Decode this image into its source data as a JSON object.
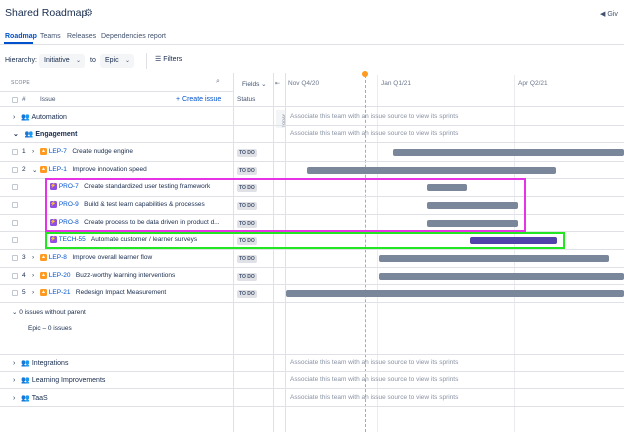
{
  "header": {
    "title": "Shared Roadmap",
    "gear_icon": "gear-icon",
    "give_label": "Giv"
  },
  "tabs": [
    {
      "label": "Roadmap",
      "active": true
    },
    {
      "label": "Teams"
    },
    {
      "label": "Releases"
    },
    {
      "label": "Dependencies report"
    }
  ],
  "toolbar": {
    "hierarchy_label": "Hierarchy:",
    "from_value": "Initiative",
    "to_label": "to",
    "to_value": "Epic",
    "filters_label": "Filters"
  },
  "table": {
    "scope_label": "SCOPE",
    "hash_label": "#",
    "issue_label": "Issue",
    "create_issue": "+ Create issue",
    "status_label": "Status",
    "fields_label": "Fields",
    "months": [
      "Nov Q4/20",
      "Jan Q1/21",
      "Apr Q2/21"
    ],
    "today_marker": "TODAY"
  },
  "rows": [
    {
      "type": "team",
      "name": "Automation",
      "bold": false,
      "assoc": "Associate this team with an issue source to view its sprints"
    },
    {
      "type": "team",
      "name": "Engagement",
      "bold": true,
      "assoc": "Associate this team with an issue source to view its sprints"
    },
    {
      "type": "issue",
      "num": "1",
      "key": "LEP-7",
      "summary": "Create nudge engine",
      "status": "TO DO",
      "icon": "initiative"
    },
    {
      "type": "issue",
      "num": "2",
      "key": "LEP-1",
      "summary": "Improve innovation speed",
      "status": "TO DO",
      "icon": "initiative"
    },
    {
      "type": "child",
      "key": "PRO-7",
      "summary": "Create standardized user testing framework",
      "status": "TO DO"
    },
    {
      "type": "child",
      "key": "PRO-9",
      "summary": "Build & test learn capabilities & processes",
      "status": "TO DO"
    },
    {
      "type": "child",
      "key": "PRO-8",
      "summary": "Create process to be data driven in product d...",
      "status": "TO DO"
    },
    {
      "type": "child",
      "key": "TECH-55",
      "summary": "Automate customer / learner surveys",
      "status": "TO DO"
    },
    {
      "type": "issue",
      "num": "3",
      "key": "LEP-8",
      "summary": "Improve overall learner flow",
      "status": "TO DO",
      "icon": "initiative"
    },
    {
      "type": "issue",
      "num": "4",
      "key": "LEP-20",
      "summary": "Buzz-worthy learning interventions",
      "status": "TO DO",
      "icon": "initiative"
    },
    {
      "type": "issue",
      "num": "5",
      "key": "LEP-21",
      "summary": "Redesign Impact Measurement",
      "status": "TO DO",
      "icon": "initiative"
    }
  ],
  "no_parent": "0 issues without parent",
  "epic_count": "Epic – 0 issues",
  "teams_bottom": [
    {
      "name": "Integrations",
      "assoc": "Associate this team with an issue source to view its sprints"
    },
    {
      "name": "Learning Improvements",
      "assoc": "Associate this team with an issue source to view its sprints"
    },
    {
      "name": "TaaS",
      "assoc": "Associate this team with an issue source to view its sprints"
    }
  ],
  "colors": {
    "accent": "#0052cc",
    "bar": "#7a869a",
    "bar_selected": "#5243aa",
    "highlight_magenta": "#e633e6",
    "highlight_green": "#22e622",
    "today": "#ff991f"
  }
}
